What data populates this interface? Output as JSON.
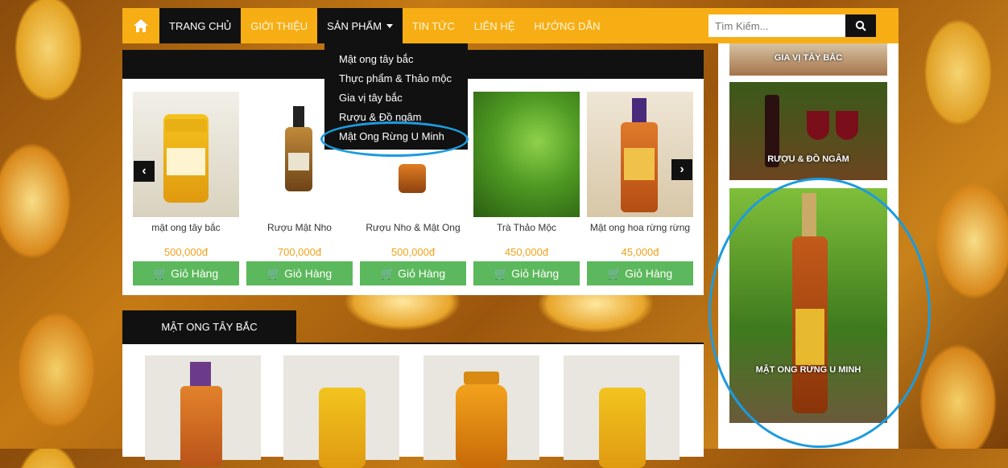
{
  "nav": {
    "items": [
      "TRANG CHỦ",
      "GIỚI THIỆU",
      "SẢN PHẨM",
      "TIN TỨC",
      "LIÊN HỆ",
      "HƯỚNG DẪN"
    ],
    "search_placeholder": "Tìm Kiếm..."
  },
  "dropdown": {
    "items": [
      "Mật ong tây bắc",
      "Thực phẩm & Thảo mộc",
      "Gia vị tây bắc",
      "Rượu & Đồ ngâm",
      "Mật Ong Rừng U Minh"
    ]
  },
  "products": [
    {
      "name": "mật ong tây bắc",
      "price": "500,000đ",
      "cart": "Giỏ Hàng"
    },
    {
      "name": "Rượu Mật Nho",
      "price": "700,000đ",
      "cart": "Giỏ Hàng"
    },
    {
      "name": "Rượu Nho & Mật Ong",
      "price": "500,000đ",
      "cart": "Giỏ Hàng"
    },
    {
      "name": "Trà Thảo Mộc",
      "price": "450,000đ",
      "cart": "Giỏ Hàng"
    },
    {
      "name": "Mật ong hoa rừng rừng",
      "price": "45,000đ",
      "cart": "Giỏ Hàng"
    }
  ],
  "section2": {
    "title": "MẬT ONG TÂY BẮC"
  },
  "sidebar": {
    "cards": [
      "GIA VỊ TÂY BẮC",
      "RƯỢU & ĐỒ NGÂM",
      "MẬT ONG RỪNG U MINH"
    ]
  },
  "colors": {
    "accent": "#f7ae15",
    "cart": "#5cb85c",
    "price": "#f0a11a",
    "highlight": "#1c9be0"
  }
}
